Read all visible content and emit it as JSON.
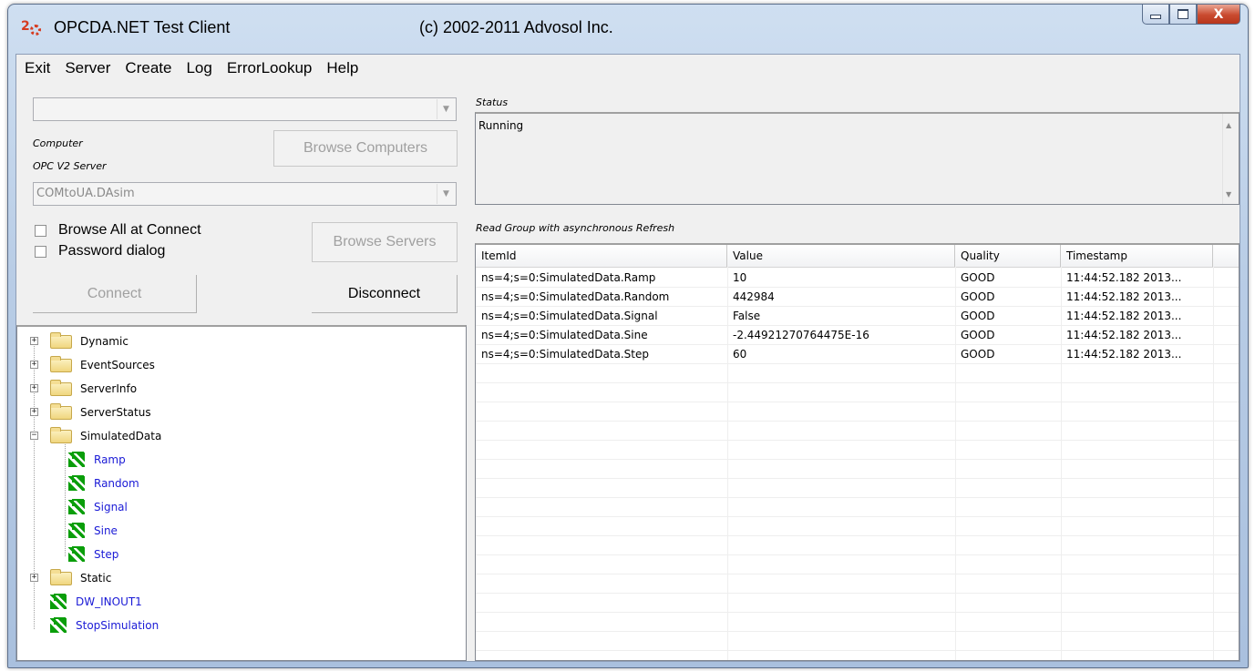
{
  "window": {
    "title": "OPCDA.NET Test Client",
    "copyright": "(c) 2002-2011 Advosol Inc.",
    "close_glyph": "X"
  },
  "menu": [
    "Exit",
    "Server",
    "Create",
    "Log",
    "ErrorLookup",
    "Help"
  ],
  "connection": {
    "computer_value": "",
    "computer_label": "Computer",
    "browse_computers_label": "Browse Computers",
    "server_label": "OPC V2 Server",
    "server_value": "COMtoUA.DAsim",
    "browse_all_label": "Browse All at Connect",
    "password_label": "Password dialog",
    "browse_servers_label": "Browse Servers",
    "connect_label": "Connect",
    "disconnect_label": "Disconnect"
  },
  "tree": [
    {
      "label": "Dynamic",
      "kind": "folder",
      "expander": "+"
    },
    {
      "label": "EventSources",
      "kind": "folder",
      "expander": "+"
    },
    {
      "label": "ServerInfo",
      "kind": "folder",
      "expander": "+"
    },
    {
      "label": "ServerStatus",
      "kind": "folder",
      "expander": "+"
    },
    {
      "label": "SimulatedData",
      "kind": "folder",
      "expander": "−"
    },
    {
      "label": "Ramp",
      "kind": "item"
    },
    {
      "label": "Random",
      "kind": "item"
    },
    {
      "label": "Signal",
      "kind": "item"
    },
    {
      "label": "Sine",
      "kind": "item"
    },
    {
      "label": "Step",
      "kind": "item"
    },
    {
      "label": "Static",
      "kind": "folder",
      "expander": "+"
    },
    {
      "label": "DW_INOUT1",
      "kind": "item"
    },
    {
      "label": "StopSimulation",
      "kind": "item"
    }
  ],
  "status": {
    "title": "Status",
    "text": "Running"
  },
  "read_group": {
    "title": "Read Group with asynchronous Refresh",
    "columns": [
      "ItemId",
      "Value",
      "Quality",
      "Timestamp"
    ],
    "rows": [
      [
        "ns=4;s=0:SimulatedData.Ramp",
        "10",
        "GOOD",
        "11:44:52.182 2013..."
      ],
      [
        "ns=4;s=0:SimulatedData.Random",
        "442984",
        "GOOD",
        "11:44:52.182 2013..."
      ],
      [
        "ns=4;s=0:SimulatedData.Signal",
        "False",
        "GOOD",
        "11:44:52.182 2013..."
      ],
      [
        "ns=4;s=0:SimulatedData.Sine",
        "-2.44921270764475E-16",
        "GOOD",
        "11:44:52.182 2013..."
      ],
      [
        "ns=4;s=0:SimulatedData.Step",
        "60",
        "GOOD",
        "11:44:52.182 2013..."
      ]
    ]
  }
}
